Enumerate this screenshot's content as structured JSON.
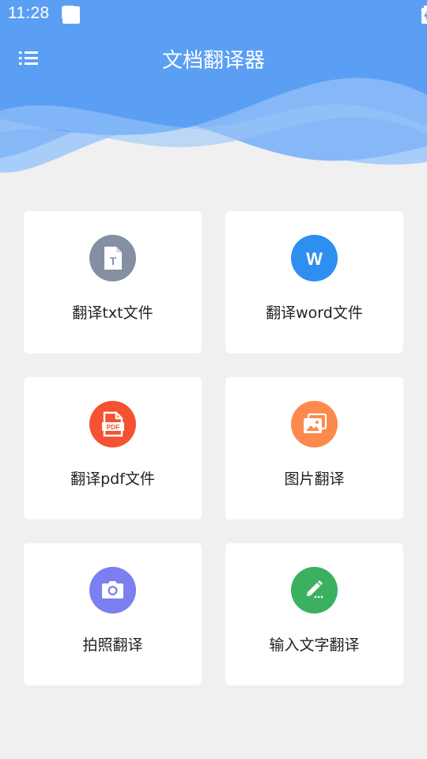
{
  "status_bar": {
    "time": "11:28",
    "left_icons": [
      "notification-square-icon",
      "download-icon",
      "a-badge-icon"
    ],
    "right_icons": [
      "wifi-icon",
      "signal-icon",
      "battery-charging-icon"
    ]
  },
  "app_bar": {
    "title": "文档翻译器",
    "menu_icon": "list-menu-icon"
  },
  "colors": {
    "header_blue": "#5aa0f5",
    "background": "#f0f0f0",
    "card": "#ffffff",
    "txt_icon": "#8490a2",
    "word_icon": "#2e8ff0",
    "pdf_icon": "#f45232",
    "image_icon": "#fb8a4c",
    "camera_icon": "#7b7ff0",
    "text_icon": "#3bb15f"
  },
  "cards": [
    {
      "label": "翻译txt文件",
      "icon": "txt-file-icon",
      "glyph": "T"
    },
    {
      "label": "翻译word文件",
      "icon": "word-file-icon",
      "glyph": "W"
    },
    {
      "label": "翻译pdf文件",
      "icon": "pdf-file-icon",
      "glyph": "PDF"
    },
    {
      "label": "图片翻译",
      "icon": "image-icon"
    },
    {
      "label": "拍照翻译",
      "icon": "camera-icon"
    },
    {
      "label": "输入文字翻译",
      "icon": "pencil-icon"
    }
  ]
}
